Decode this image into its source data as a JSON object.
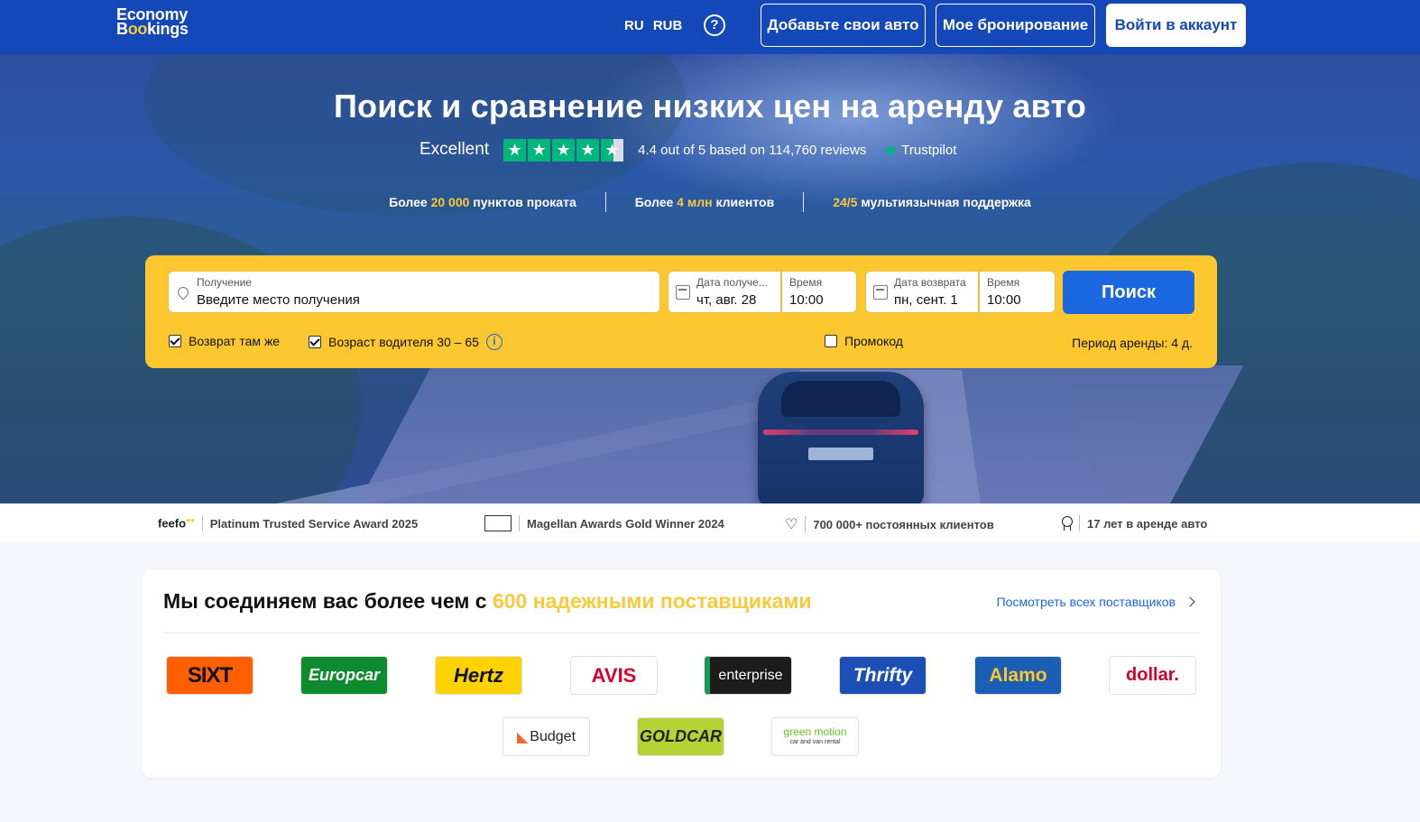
{
  "header": {
    "logo_line1": "Economy",
    "logo_line2_a": "B",
    "logo_line2_o": "oo",
    "logo_line2_b": "kings",
    "language": "RU",
    "currency": "RUB",
    "add_car": "Добавьте свои авто",
    "my_booking": "Мое бронирование",
    "login": "Войти в аккаунт"
  },
  "hero": {
    "title": "Поиск и сравнение низких цен на аренду авто",
    "rating_word": "Excellent",
    "rating_value": 4.4,
    "rating_text": "4.4 out of 5 based on 114,760 reviews",
    "trustpilot": "Trustpilot",
    "stats": [
      {
        "pre": "Более ",
        "hl": "20 000",
        "post": " пунктов проката"
      },
      {
        "pre": "Более ",
        "hl": "4 млн",
        "post": " клиентов"
      },
      {
        "pre": "",
        "hl": "24/5",
        "post": " мультиязычная поддержка"
      }
    ]
  },
  "search": {
    "pickup_label": "Получение",
    "pickup_placeholder": "Введите место получения",
    "pickup_date_label": "Дата получе...",
    "pickup_date_value": "чт, авг. 28",
    "pickup_time_label": "Время",
    "pickup_time_value": "10:00",
    "return_date_label": "Дата возврата",
    "return_date_value": "пн, сент. 1",
    "return_time_label": "Время",
    "return_time_value": "10:00",
    "search_button": "Поиск",
    "same_return": "Возврат там же",
    "driver_age": "Возраст водителя 30 – 65",
    "promo": "Промокод",
    "rental_period": "Период аренды: 4 д."
  },
  "awards": [
    {
      "brand": "feefo",
      "text": "Platinum Trusted Service Award 2025"
    },
    {
      "brand": "MAGELLAN AWARDS",
      "text": "Magellan Awards Gold Winner 2024"
    },
    {
      "text": "700 000+ постоянных клиентов"
    },
    {
      "text": "17 лет в аренде авто"
    }
  ],
  "suppliers": {
    "title_pre": "Мы соединяем вас более чем с ",
    "title_hl": "600 надежными поставщиками",
    "see_all": "Посмотреть всех поставщиков",
    "logos": [
      "SIXT",
      "Europcar",
      "Hertz",
      "AVIS",
      "enterprise",
      "Thrifty",
      "Alamo",
      "dollar.",
      "Budget",
      "GOLDCAR",
      "green motion",
      "car and van rental"
    ]
  },
  "colors": {
    "brand_blue": "#1448b8",
    "accent_yellow": "#fdc82f",
    "search_blue": "#1a67e0",
    "trustpilot_green": "#00b67a"
  }
}
